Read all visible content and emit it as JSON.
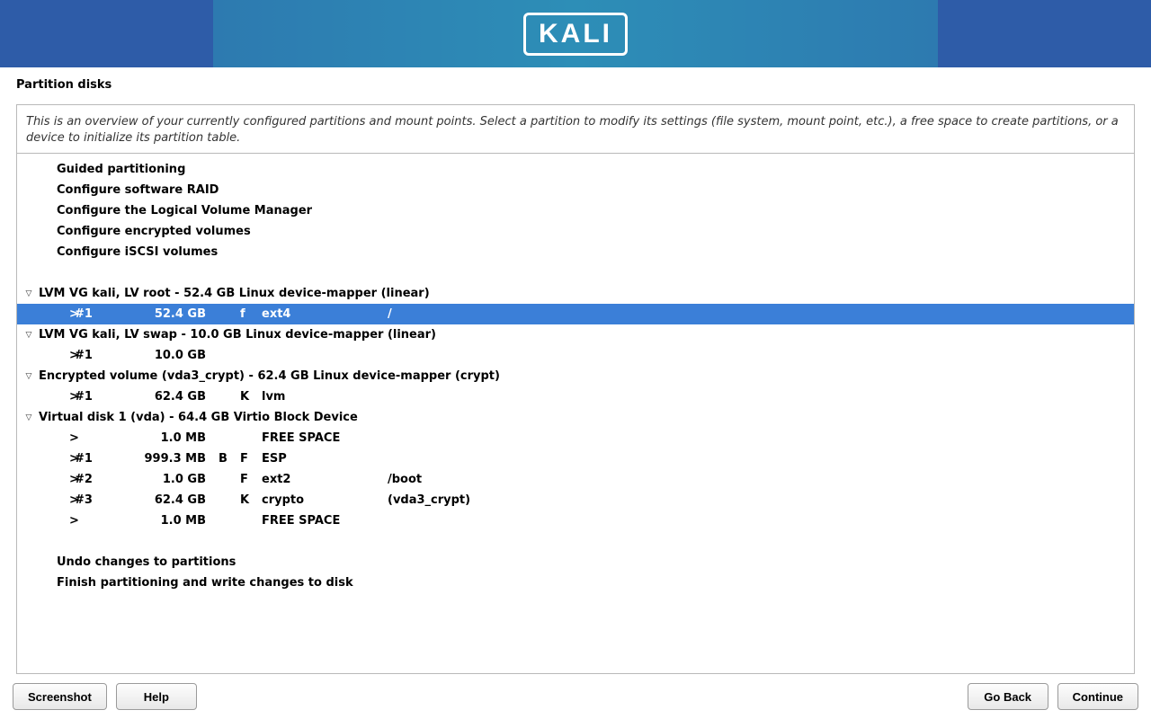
{
  "banner": {
    "logo_text": "KALI"
  },
  "page": {
    "title": "Partition disks",
    "intro": "This is an overview of your currently configured partitions and mount points. Select a partition to modify its settings (file system, mount point, etc.), a free space to create partitions, or a device to initialize its partition table."
  },
  "actions_top": [
    "Guided partitioning",
    "Configure software RAID",
    "Configure the Logical Volume Manager",
    "Configure encrypted volumes",
    "Configure iSCSI volumes"
  ],
  "devices": [
    {
      "label": "LVM VG kali, LV root - 52.4 GB Linux device-mapper (linear)",
      "partitions": [
        {
          "arrow": ">",
          "num": "#1",
          "size": "52.4 GB",
          "f1": "",
          "f2": "f",
          "fs": "ext4",
          "mnt": "/",
          "selected": true
        }
      ]
    },
    {
      "label": "LVM VG kali, LV swap - 10.0 GB Linux device-mapper (linear)",
      "partitions": [
        {
          "arrow": ">",
          "num": "#1",
          "size": "10.0 GB",
          "f1": "",
          "f2": "",
          "fs": "",
          "mnt": "",
          "selected": false
        }
      ]
    },
    {
      "label": "Encrypted volume (vda3_crypt) - 62.4 GB Linux device-mapper (crypt)",
      "partitions": [
        {
          "arrow": ">",
          "num": "#1",
          "size": "62.4 GB",
          "f1": "",
          "f2": "K",
          "fs": "lvm",
          "mnt": "",
          "selected": false
        }
      ]
    },
    {
      "label": "Virtual disk 1 (vda) - 64.4 GB Virtio Block Device",
      "partitions": [
        {
          "arrow": ">",
          "num": "",
          "size": "1.0 MB",
          "f1": "",
          "f2": "",
          "fs": "FREE SPACE",
          "mnt": "",
          "selected": false
        },
        {
          "arrow": ">",
          "num": "#1",
          "size": "999.3 MB",
          "f1": "B",
          "f2": "F",
          "fs": "ESP",
          "mnt": "",
          "selected": false
        },
        {
          "arrow": ">",
          "num": "#2",
          "size": "1.0 GB",
          "f1": "",
          "f2": "F",
          "fs": "ext2",
          "mnt": "/boot",
          "selected": false
        },
        {
          "arrow": ">",
          "num": "#3",
          "size": "62.4 GB",
          "f1": "",
          "f2": "K",
          "fs": "crypto",
          "mnt": "(vda3_crypt)",
          "selected": false
        },
        {
          "arrow": ">",
          "num": "",
          "size": "1.0 MB",
          "f1": "",
          "f2": "",
          "fs": "FREE SPACE",
          "mnt": "",
          "selected": false
        }
      ]
    }
  ],
  "actions_bottom": [
    "Undo changes to partitions",
    "Finish partitioning and write changes to disk"
  ],
  "buttons": {
    "screenshot": "Screenshot",
    "help": "Help",
    "go_back": "Go Back",
    "continue": "Continue"
  }
}
